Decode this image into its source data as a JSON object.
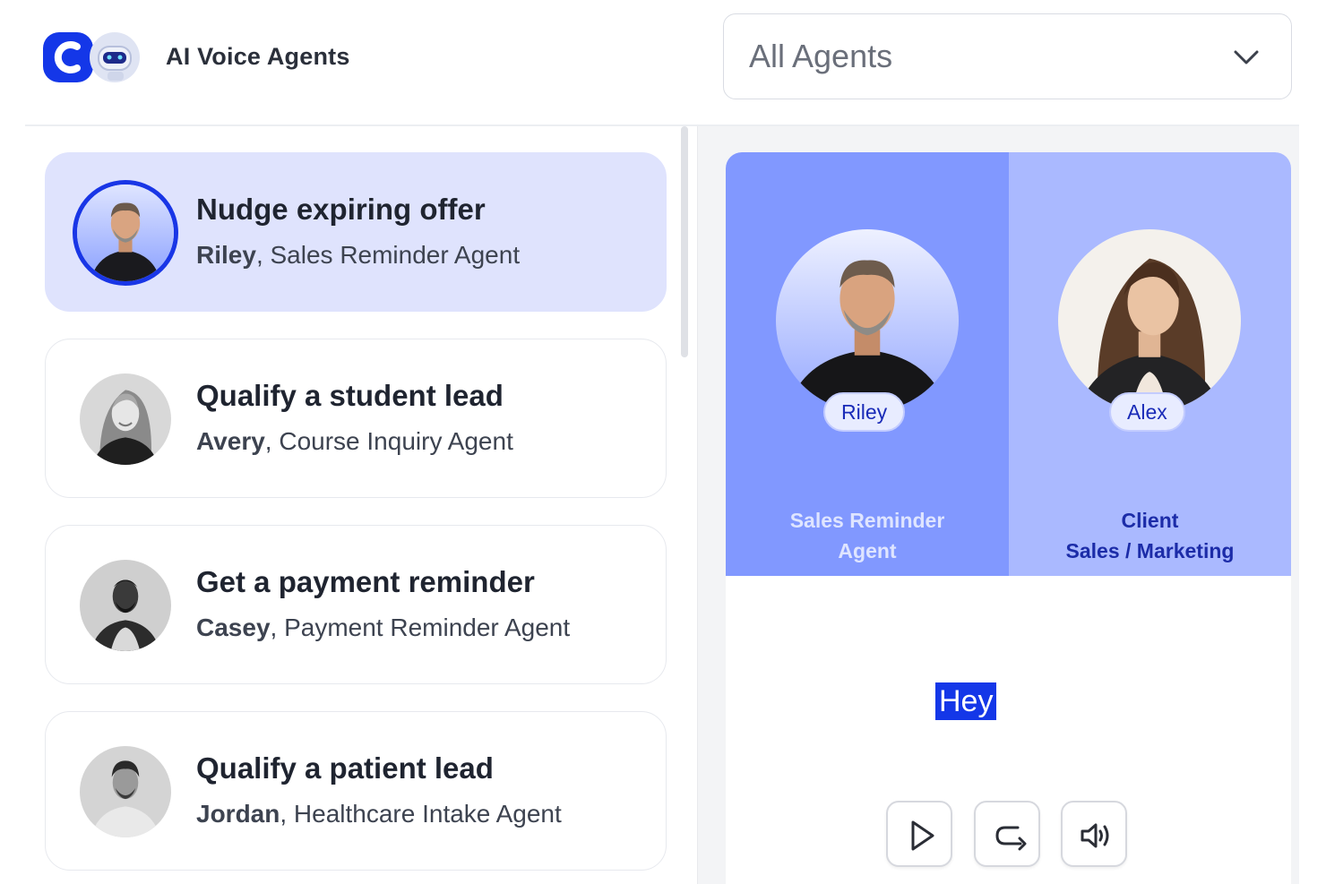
{
  "header": {
    "app_title": "AI Voice Agents",
    "agent_filter": {
      "selected": "All Agents"
    }
  },
  "scenarios": [
    {
      "title": "Nudge expiring offer",
      "agent_name": "Riley",
      "agent_role": ", Sales Reminder Agent",
      "active": true
    },
    {
      "title": "Qualify a student lead",
      "agent_name": "Avery",
      "agent_role": ", Course Inquiry Agent",
      "active": false
    },
    {
      "title": "Get a payment reminder",
      "agent_name": "Casey",
      "agent_role": ", Payment Reminder Agent",
      "active": false
    },
    {
      "title": "Qualify a patient lead",
      "agent_name": "Jordan",
      "agent_role": ", Healthcare Intake Agent",
      "active": false
    }
  ],
  "call": {
    "agent": {
      "name": "Riley",
      "role_line1": "Sales Reminder",
      "role_line2": "Agent"
    },
    "client": {
      "name": "Alex",
      "role_line1": "Client",
      "role_line2": "Sales / Marketing"
    },
    "transcript": "Hey"
  },
  "controls": {
    "play": "play-icon",
    "replay": "return-icon",
    "volume": "volume-icon"
  },
  "colors": {
    "accent": "#1437e8",
    "active_card": "#dfe3fd",
    "agent_column": "#8198ff",
    "client_column": "#aab9ff"
  }
}
